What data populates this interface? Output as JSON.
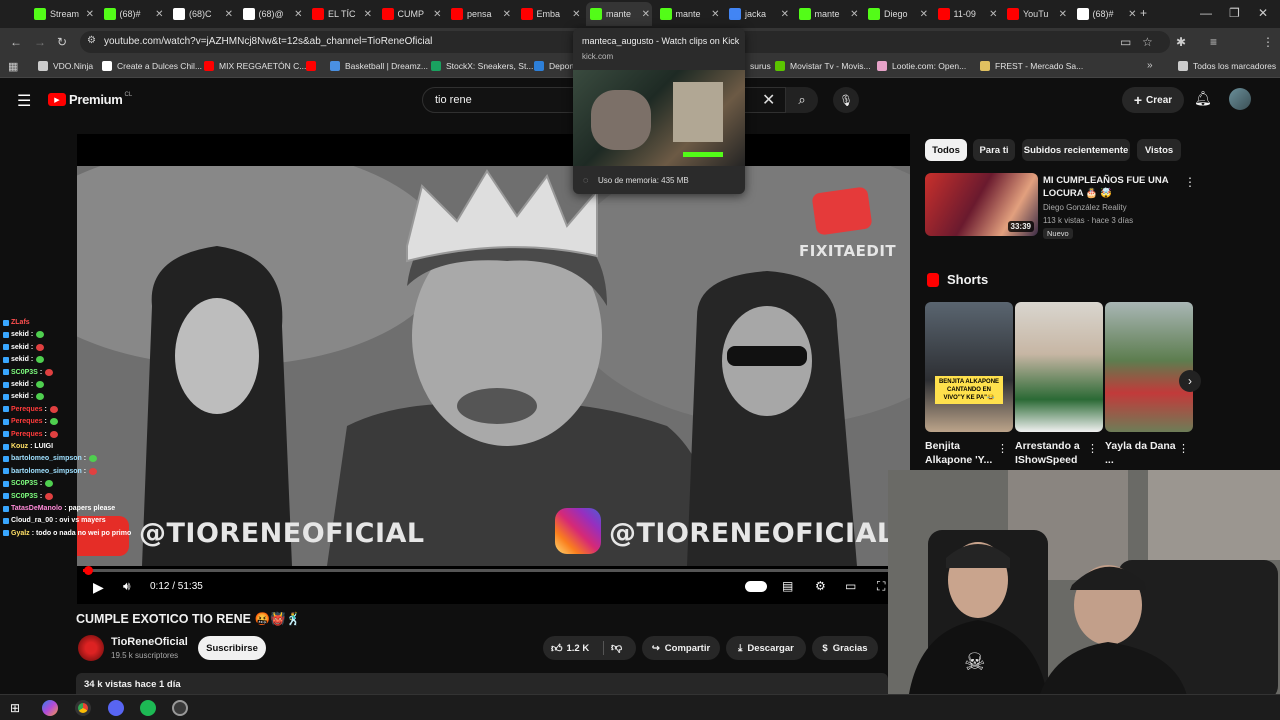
{
  "tabs": [
    {
      "label": "Stream",
      "icon": "kick-icon",
      "color": "#53fc18"
    },
    {
      "label": "(68)#",
      "icon": "kick-icon",
      "color": "#53fc18"
    },
    {
      "label": "(68)C",
      "icon": "tiktok-icon",
      "color": "#ffffff"
    },
    {
      "label": "(68)@",
      "icon": "tiktok-icon",
      "color": "#ffffff"
    },
    {
      "label": "EL TÍC",
      "icon": "youtube-icon",
      "color": "#ff0000"
    },
    {
      "label": "CUMP",
      "icon": "youtube-icon",
      "color": "#ff0000"
    },
    {
      "label": "pensa",
      "icon": "youtube-icon",
      "color": "#ff0000"
    },
    {
      "label": "Emba",
      "icon": "youtube-icon",
      "color": "#ff0000"
    },
    {
      "label": "mante",
      "icon": "kick-icon",
      "color": "#53fc18"
    },
    {
      "label": "mante",
      "icon": "kick-icon",
      "color": "#53fc18"
    },
    {
      "label": "jacka",
      "icon": "google-icon",
      "color": "#4285f4"
    },
    {
      "label": "mante",
      "icon": "kick-icon",
      "color": "#53fc18"
    },
    {
      "label": "Diego",
      "icon": "kick-icon",
      "color": "#53fc18"
    },
    {
      "label": "11-09",
      "icon": "youtube-icon",
      "color": "#ff0000"
    },
    {
      "label": "YouTu",
      "icon": "youtube-icon",
      "color": "#ff0000"
    },
    {
      "label": "(68)#",
      "icon": "tiktok-icon",
      "color": "#ffffff"
    }
  ],
  "address": {
    "url": "youtube.com/watch?v=jAZHMNcj8Nw&t=12s&ab_channel=TioReneOficial"
  },
  "bookmarks": [
    {
      "label": "VDO.Ninja",
      "color": "#cccccc"
    },
    {
      "label": "Create a Dulces Chil...",
      "color": "#ffffff"
    },
    {
      "label": "MIX REGGAETÓN C...",
      "color": "#ff0000"
    },
    {
      "label": "",
      "color": "#ff0000"
    },
    {
      "label": "Basketball | Dreamz...",
      "color": "#4a90e2"
    },
    {
      "label": "StockX: Sneakers, St...",
      "color": "#1aa260"
    },
    {
      "label": "Deport",
      "color": "#2d7fd8"
    },
    {
      "label": "surus",
      "color": "#cccccc"
    },
    {
      "label": "Movistar Tv - Movis...",
      "color": "#5bc500"
    },
    {
      "label": "Lootie.com: Open...",
      "color": "#e6a2c8"
    },
    {
      "label": "FREST - Mercado Sa...",
      "color": "#e0c060"
    },
    {
      "label": "Todos los marcadores",
      "color": "#cccccc"
    }
  ],
  "youtube": {
    "logo": "Premium",
    "region": "CL",
    "search_value": "tio rene",
    "create_label": "Crear"
  },
  "popup": {
    "title": "manteca_augusto - Watch clips on Kick",
    "domain": "kick.com",
    "memory": "Uso de memoria: 435 MB"
  },
  "video": {
    "time": "0:12 / 51:35",
    "progress_fraction": 0.004,
    "watermark_brand": "FIXITAEDIT",
    "watermark_handle_left": "@TIORENEOFICIAL",
    "watermark_handle_right": "@TIORENEOFICIAL",
    "title": "CUMPLE EXOTICO TIO RENE 🤬👹🕺",
    "channel": "TioReneOficial",
    "subscribers": "19.5 k suscriptores",
    "subscribe_label": "Suscribirse",
    "likes": "1.2 K",
    "share_label": "Compartir",
    "download_label": "Descargar",
    "thanks_label": "Gracias",
    "views": "34 k vistas  hace 1 día"
  },
  "chat": [
    {
      "user": "ZLafs",
      "msg": "",
      "color": "#ff4f4f"
    },
    {
      "user": "sekid",
      "msg": ":",
      "color": "#ffffff"
    },
    {
      "user": "sekid",
      "msg": ":",
      "color": "#ffffff"
    },
    {
      "user": "sekid",
      "msg": ":",
      "color": "#ffffff"
    },
    {
      "user": "SC0P3S",
      "msg": ":",
      "color": "#7fff7f"
    },
    {
      "user": "sekid",
      "msg": ":",
      "color": "#ffffff"
    },
    {
      "user": "sekid",
      "msg": ":",
      "color": "#ffffff"
    },
    {
      "user": "Pereques",
      "msg": ":",
      "color": "#ff3b3b"
    },
    {
      "user": "Pereques",
      "msg": ":",
      "color": "#ff3b3b"
    },
    {
      "user": "Pereques",
      "msg": ":",
      "color": "#ff3b3b"
    },
    {
      "user": "Kouz",
      "msg": ": LUIGI",
      "color": "#ffe066"
    },
    {
      "user": "bartolomeo_simpson",
      "msg": ":",
      "color": "#9fe0ff"
    },
    {
      "user": "bartolomeo_simpson",
      "msg": ":",
      "color": "#9fe0ff"
    },
    {
      "user": "SC0P3S",
      "msg": ":",
      "color": "#7fff7f"
    },
    {
      "user": "SC0P3S",
      "msg": ":",
      "color": "#7fff7f"
    },
    {
      "user": "TatasDeManolo",
      "msg": ": papers please",
      "color": "#ff8ad8"
    },
    {
      "user": "Cloud_ra_00",
      "msg": ": ovi vs mayers",
      "color": "#ffffff"
    },
    {
      "user": "Gyalz",
      "msg": ": todo o nada no wei po primo",
      "color": "#ffe066"
    }
  ],
  "filters": [
    "Todos",
    "Para ti",
    "Subidos recientemente",
    "Vistos"
  ],
  "recommended": {
    "title": "MI CUMPLEAÑOS FUE UNA LOCURA 🎂 🤯",
    "channel": "Diego González Reality",
    "meta": "113 k vistas · hace 3 días",
    "badge": "Nuevo",
    "duration": "33:39"
  },
  "shorts": {
    "heading": "Shorts",
    "items": [
      {
        "title": "Benjita Alkapone 'Y...",
        "overlay": "BENJITA ALKAPONE CANTANDO EN VIVO\"Y KE PA\"😂"
      },
      {
        "title": "Arrestando a IShowSpeed",
        "overlay": ""
      },
      {
        "title": "Yayla da Dana ...",
        "overlay": ""
      }
    ]
  },
  "colors": {
    "accent": "#ff0000",
    "kick": "#53fc18",
    "bg": "#0f0f0f"
  }
}
